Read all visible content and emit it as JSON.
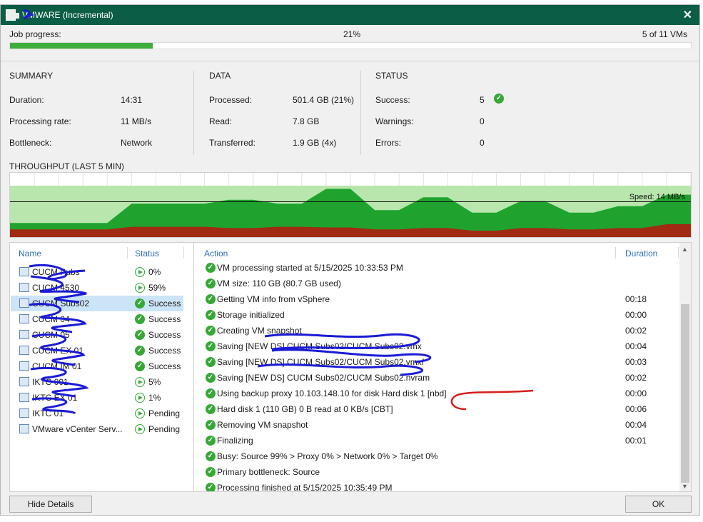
{
  "window": {
    "title": "VMWARE (Incremental)"
  },
  "progress": {
    "label": "Job progress:",
    "percent_text": "21%",
    "percent": 21,
    "vms_text": "5 of 11 VMs"
  },
  "summary": {
    "title": "SUMMARY",
    "duration_label": "Duration:",
    "duration_value": "14:31",
    "rate_label": "Processing rate:",
    "rate_value": "11 MB/s",
    "bottleneck_label": "Bottleneck:",
    "bottleneck_value": "Network"
  },
  "data_section": {
    "title": "DATA",
    "processed_label": "Processed:",
    "processed_value": "501.4 GB (21%)",
    "read_label": "Read:",
    "read_value": "7.8 GB",
    "transferred_label": "Transferred:",
    "transferred_value": "1.9 GB (4x)"
  },
  "status_section": {
    "title": "STATUS",
    "success_label": "Success:",
    "success_value": "5",
    "warnings_label": "Warnings:",
    "warnings_value": "0",
    "errors_label": "Errors:",
    "errors_value": "0"
  },
  "throughput": {
    "title": "THROUGHPUT (LAST 5 MIN)",
    "speed_label": "Speed: 14 MB/s",
    "colors": {
      "background": "#b9e6ad",
      "processing": "#1fa32e",
      "read": "#a12a12"
    }
  },
  "chart_data": {
    "type": "area",
    "title": "THROUGHPUT (LAST 5 MIN)",
    "x": [
      0,
      1,
      2,
      3,
      4,
      5,
      6,
      7,
      8,
      9,
      10,
      11,
      12,
      13,
      14,
      15,
      16,
      17,
      18,
      19,
      20,
      21,
      22,
      23,
      24,
      25,
      26,
      27,
      28
    ],
    "series": [
      {
        "values": [
          0.22,
          0.22,
          0.22,
          0.22,
          0.22,
          0.52,
          0.52,
          0.52,
          0.52,
          0.58,
          0.58,
          0.52,
          0.52,
          0.75,
          0.75,
          0.42,
          0.42,
          0.62,
          0.62,
          0.38,
          0.38,
          0.56,
          0.56,
          0.38,
          0.38,
          0.48,
          0.48,
          0.66,
          0.66
        ]
      },
      {
        "values": [
          0.12,
          0.12,
          0.12,
          0.12,
          0.12,
          0.16,
          0.16,
          0.16,
          0.16,
          0.14,
          0.14,
          0.16,
          0.16,
          0.15,
          0.15,
          0.12,
          0.12,
          0.14,
          0.14,
          0.1,
          0.1,
          0.14,
          0.14,
          0.12,
          0.12,
          0.14,
          0.14,
          0.2,
          0.2
        ]
      }
    ],
    "speed_line": 0.55,
    "grid": true
  },
  "vm_list": {
    "name_header": "Name",
    "status_header": "Status",
    "rows": [
      {
        "name": "CUCM Pubs",
        "status": "0%",
        "kind": "running"
      },
      {
        "name": "CUCM 4530",
        "status": "59%",
        "kind": "running"
      },
      {
        "name": "CUCM Subs02",
        "status": "Success",
        "kind": "success",
        "selected": true
      },
      {
        "name": "CUCM 04",
        "status": "Success",
        "kind": "success"
      },
      {
        "name": "CUCM 05",
        "status": "Success",
        "kind": "success"
      },
      {
        "name": "CUCM EX 01",
        "status": "Success",
        "kind": "success"
      },
      {
        "name": "CUCM IM 01",
        "status": "Success",
        "kind": "success"
      },
      {
        "name": "IKTC 001",
        "status": "5%",
        "kind": "running"
      },
      {
        "name": "IKTC EX 01",
        "status": "1%",
        "kind": "running"
      },
      {
        "name": "IKTC 01",
        "status": "Pending",
        "kind": "running"
      },
      {
        "name": "VMware vCenter Serv...",
        "status": "Pending",
        "kind": "running"
      }
    ]
  },
  "actions": {
    "action_header": "Action",
    "duration_header": "Duration",
    "rows": [
      {
        "text": "VM processing started at 5/15/2025 10:33:53 PM",
        "duration": ""
      },
      {
        "text": "VM size: 110 GB (80.7 GB used)",
        "duration": ""
      },
      {
        "text": "Getting VM info from vSphere",
        "duration": "00:18"
      },
      {
        "text": "Storage initialized",
        "duration": "00:00"
      },
      {
        "text": "Creating VM snapshot",
        "duration": "00:02"
      },
      {
        "text": "Saving [NEW DS] CUCM Subs02/CUCM Subs02.vmx",
        "duration": "00:04"
      },
      {
        "text": "Saving [NEW DS] CUCM Subs02/CUCM Subs02.vmxf",
        "duration": "00:03"
      },
      {
        "text": "Saving [NEW DS] CUCM Subs02/CUCM Subs02.nvram",
        "duration": "00:02"
      },
      {
        "text": "Using backup proxy 10.103.148.10 for disk Hard disk 1 [nbd]",
        "duration": "00:00"
      },
      {
        "text": "Hard disk 1 (110 GB) 0 B read at 0 KB/s [CBT]",
        "duration": "00:06"
      },
      {
        "text": "Removing VM snapshot",
        "duration": "00:04"
      },
      {
        "text": "Finalizing",
        "duration": "00:01"
      },
      {
        "text": "Busy: Source 99% > Proxy 0% > Network 0% > Target 0%",
        "duration": ""
      },
      {
        "text": "Primary bottleneck: Source",
        "duration": ""
      },
      {
        "text": "Processing finished at 5/15/2025 10:35:49 PM",
        "duration": ""
      }
    ]
  },
  "buttons": {
    "hide_details": "Hide Details",
    "ok": "OK"
  }
}
